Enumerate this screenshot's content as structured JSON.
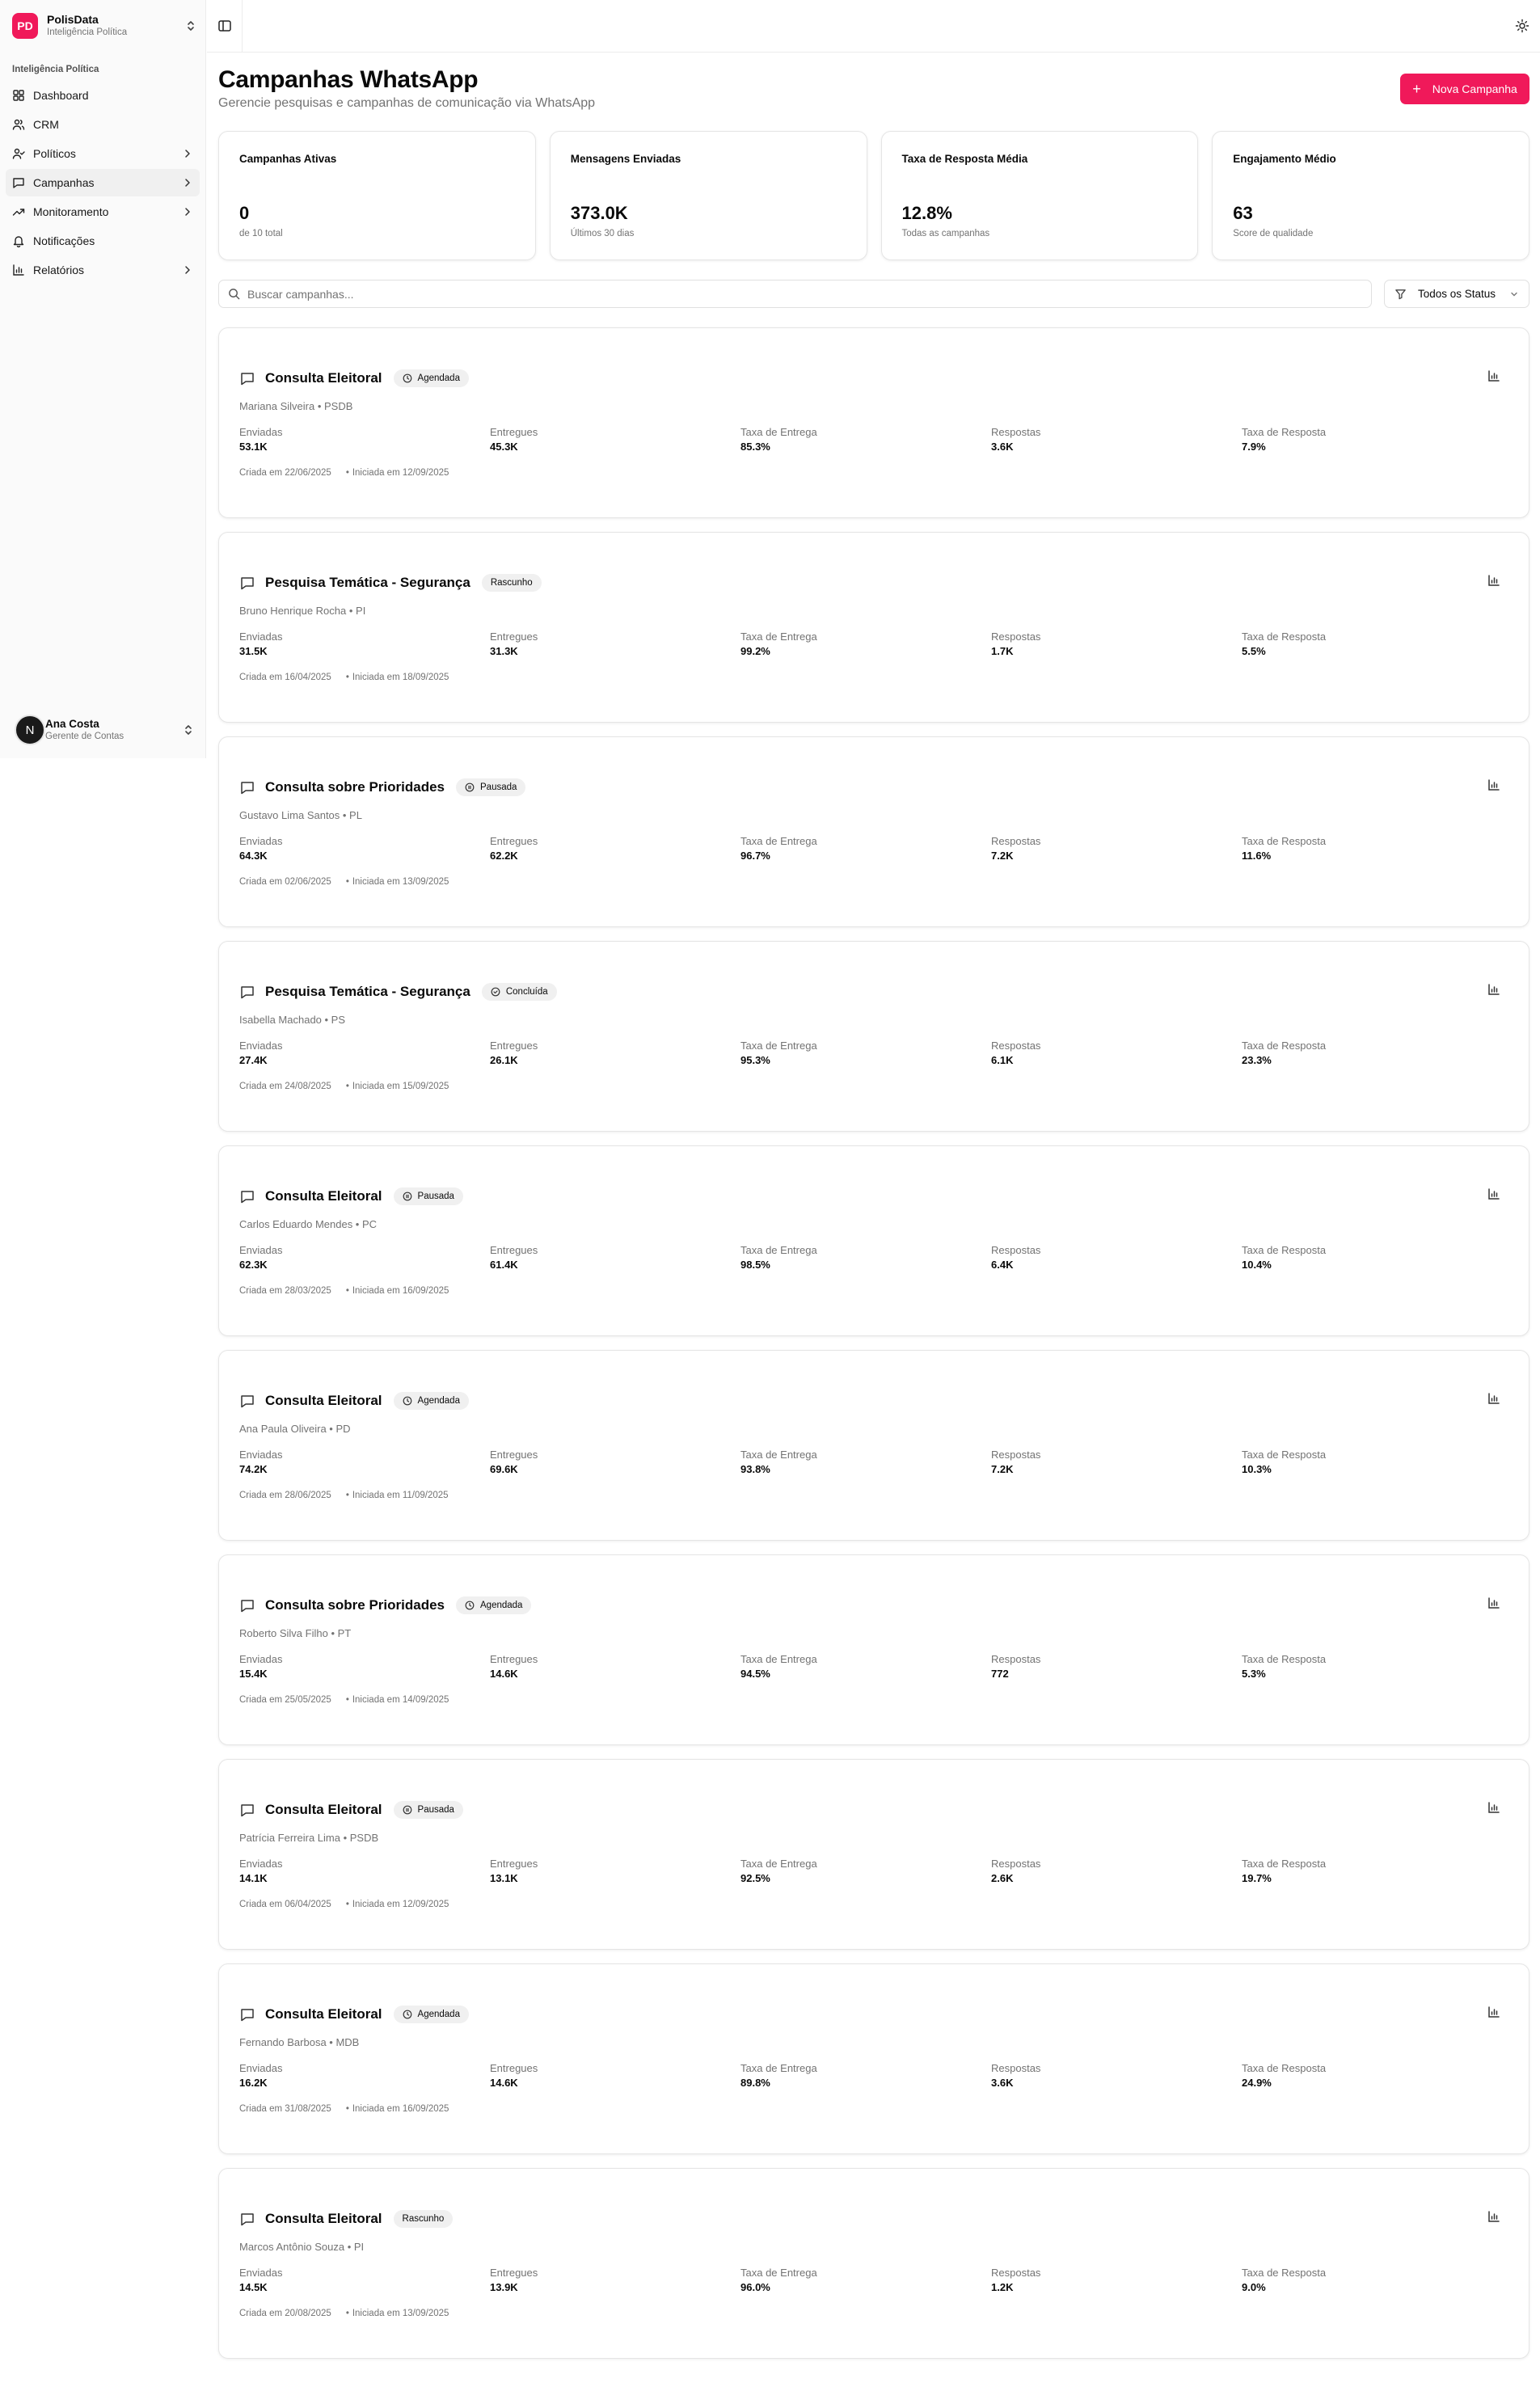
{
  "app": {
    "brand_initials": "PD",
    "brand_name": "PolisData",
    "brand_tagline": "Inteligência Política",
    "accent": "#f0195a"
  },
  "sidebar": {
    "group_label": "Inteligência Política",
    "items": [
      {
        "label": "Dashboard",
        "icon": "grid-icon",
        "chevron": false
      },
      {
        "label": "CRM",
        "icon": "users-icon",
        "chevron": false
      },
      {
        "label": "Políticos",
        "icon": "user-check-icon",
        "chevron": true
      },
      {
        "label": "Campanhas",
        "icon": "message-square-icon",
        "chevron": true,
        "active": true
      },
      {
        "label": "Monitoramento",
        "icon": "trending-up-icon",
        "chevron": true
      },
      {
        "label": "Notificações",
        "icon": "bell-icon",
        "chevron": false
      },
      {
        "label": "Relatórios",
        "icon": "bar-chart-icon",
        "chevron": true
      }
    ],
    "user": {
      "initial": "N",
      "name": "Ana Costa",
      "role": "Gerente de Contas"
    }
  },
  "header": {
    "title": "Campanhas WhatsApp",
    "subtitle": "Gerencie pesquisas e campanhas de comunicação via WhatsApp",
    "new_button": "Nova Campanha"
  },
  "stats": [
    {
      "label": "Campanhas Ativas",
      "value": "0",
      "sub": "de 10 total"
    },
    {
      "label": "Mensagens Enviadas",
      "value": "373.0K",
      "sub": "Últimos 30 dias"
    },
    {
      "label": "Taxa de Resposta Média",
      "value": "12.8%",
      "sub": "Todas as campanhas"
    },
    {
      "label": "Engajamento Médio",
      "value": "63",
      "sub": "Score de qualidade"
    }
  ],
  "search": {
    "placeholder": "Buscar campanhas...",
    "value": ""
  },
  "status_filter": {
    "selected": "Todos os Status"
  },
  "metric_labels": [
    "Enviadas",
    "Entregues",
    "Taxa de Entrega",
    "Respostas",
    "Taxa de Resposta"
  ],
  "campaigns": [
    {
      "title": "Consulta Eleitoral",
      "status": "Agendada",
      "status_icon": "clock-icon",
      "owner": "Mariana Silveira • PSDB",
      "metrics": [
        "53.1K",
        "45.3K",
        "85.3%",
        "3.6K",
        "7.9%"
      ],
      "created": "Criada em 22/06/2025",
      "started": "Iniciada em 12/09/2025"
    },
    {
      "title": "Pesquisa Temática - Segurança",
      "status": "Rascunho",
      "status_icon": "",
      "owner": "Bruno Henrique Rocha • PI",
      "metrics": [
        "31.5K",
        "31.3K",
        "99.2%",
        "1.7K",
        "5.5%"
      ],
      "created": "Criada em 16/04/2025",
      "started": "Iniciada em 18/09/2025"
    },
    {
      "title": "Consulta sobre Prioridades",
      "status": "Pausada",
      "status_icon": "pause-circle-icon",
      "owner": "Gustavo Lima Santos • PL",
      "metrics": [
        "64.3K",
        "62.2K",
        "96.7%",
        "7.2K",
        "11.6%"
      ],
      "created": "Criada em 02/06/2025",
      "started": "Iniciada em 13/09/2025"
    },
    {
      "title": "Pesquisa Temática - Segurança",
      "status": "Concluída",
      "status_icon": "check-circle-icon",
      "owner": "Isabella Machado • PS",
      "metrics": [
        "27.4K",
        "26.1K",
        "95.3%",
        "6.1K",
        "23.3%"
      ],
      "created": "Criada em 24/08/2025",
      "started": "Iniciada em 15/09/2025"
    },
    {
      "title": "Consulta Eleitoral",
      "status": "Pausada",
      "status_icon": "pause-circle-icon",
      "owner": "Carlos Eduardo Mendes • PC",
      "metrics": [
        "62.3K",
        "61.4K",
        "98.5%",
        "6.4K",
        "10.4%"
      ],
      "created": "Criada em 28/03/2025",
      "started": "Iniciada em 16/09/2025"
    },
    {
      "title": "Consulta Eleitoral",
      "status": "Agendada",
      "status_icon": "clock-icon",
      "owner": "Ana Paula Oliveira • PD",
      "metrics": [
        "74.2K",
        "69.6K",
        "93.8%",
        "7.2K",
        "10.3%"
      ],
      "created": "Criada em 28/06/2025",
      "started": "Iniciada em 11/09/2025"
    },
    {
      "title": "Consulta sobre Prioridades",
      "status": "Agendada",
      "status_icon": "clock-icon",
      "owner": "Roberto Silva Filho • PT",
      "metrics": [
        "15.4K",
        "14.6K",
        "94.5%",
        "772",
        "5.3%"
      ],
      "created": "Criada em 25/05/2025",
      "started": "Iniciada em 14/09/2025"
    },
    {
      "title": "Consulta Eleitoral",
      "status": "Pausada",
      "status_icon": "pause-circle-icon",
      "owner": "Patrícia Ferreira Lima • PSDB",
      "metrics": [
        "14.1K",
        "13.1K",
        "92.5%",
        "2.6K",
        "19.7%"
      ],
      "created": "Criada em 06/04/2025",
      "started": "Iniciada em 12/09/2025"
    },
    {
      "title": "Consulta Eleitoral",
      "status": "Agendada",
      "status_icon": "clock-icon",
      "owner": "Fernando Barbosa • MDB",
      "metrics": [
        "16.2K",
        "14.6K",
        "89.8%",
        "3.6K",
        "24.9%"
      ],
      "created": "Criada em 31/08/2025",
      "started": "Iniciada em 16/09/2025"
    },
    {
      "title": "Consulta Eleitoral",
      "status": "Rascunho",
      "status_icon": "",
      "owner": "Marcos Antônio Souza • PI",
      "metrics": [
        "14.5K",
        "13.9K",
        "96.0%",
        "1.2K",
        "9.0%"
      ],
      "created": "Criada em 20/08/2025",
      "started": "Iniciada em 13/09/2025"
    }
  ]
}
